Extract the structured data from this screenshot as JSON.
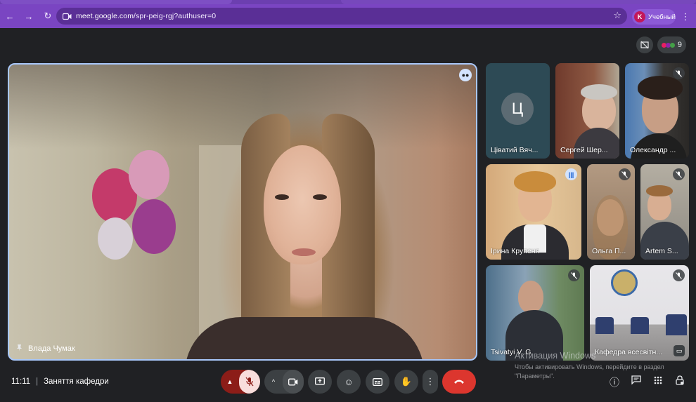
{
  "browser": {
    "url_host": "meet.google.com",
    "url_path": "/spr-peig-rgj?authuser=0",
    "profile_initial": "K",
    "profile_name": "Учебный"
  },
  "top_bar": {
    "participant_count": "9"
  },
  "main_video": {
    "name": "Влада Чумак"
  },
  "tiles": [
    {
      "name": "Ціватий Вяч...",
      "avatar_letter": "Ц",
      "mic": "none"
    },
    {
      "name": "Сергей Шер...",
      "mic": "none"
    },
    {
      "name": "Олександр ...",
      "mic": "muted"
    },
    {
      "name": "Ірина Крупеня",
      "mic": "speaking"
    },
    {
      "name": "Ольга П...",
      "mic": "muted"
    },
    {
      "name": "Artem S...",
      "mic": "muted"
    },
    {
      "name": "Tsivatyi V. G.",
      "mic": "muted"
    },
    {
      "name": "Кафедра всесвітн...",
      "mic": "muted"
    }
  ],
  "bottom_bar": {
    "time": "11:11",
    "meeting_title": "Заняття кафедри"
  },
  "watermark": {
    "line1": "Активация Windows",
    "line2": "Чтобы активировать Windows, перейдите в раздел",
    "line3": "\"Параметры\"."
  },
  "colors": {
    "browser_accent": "#7a45c2",
    "meet_bg": "#202124",
    "active_speaker_border": "#a8c7fa",
    "hangup": "#dc362e"
  },
  "icons": {
    "back": "arrow-left-icon",
    "forward": "arrow-right-icon",
    "reload": "reload-icon",
    "bookmark": "star-icon",
    "hand": "raise-hand-icon"
  }
}
